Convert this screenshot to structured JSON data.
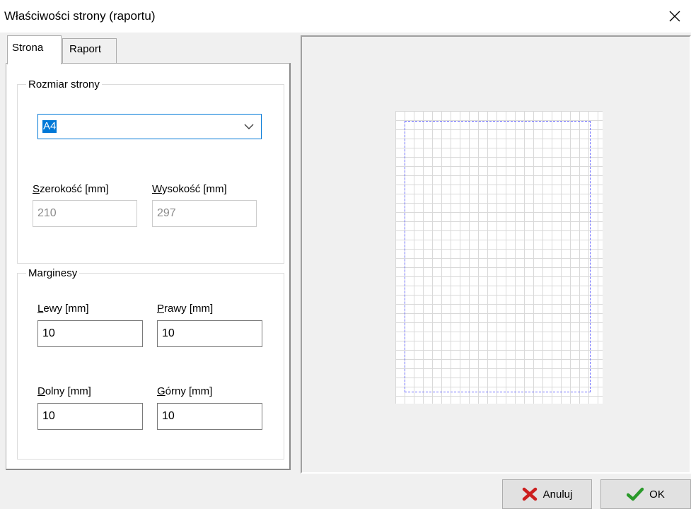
{
  "window": {
    "title": "Właściwości strony (raportu)",
    "close_icon": "close-icon"
  },
  "tabs": [
    {
      "label": "Strona",
      "active": true
    },
    {
      "label": "Raport",
      "active": false
    }
  ],
  "page_size_group": {
    "label": "Rozmiar strony",
    "selected": "A4",
    "width_label_accel": "S",
    "width_label_rest": "zerokość [mm]",
    "width_value": "210",
    "height_label_accel": "W",
    "height_label_rest": "ysokość [mm]",
    "height_value": "297"
  },
  "margins_group": {
    "label": "Marginesy",
    "left_label_accel": "L",
    "left_label_rest": "ewy [mm]",
    "left_value": "10",
    "right_label_accel": "P",
    "right_label_rest": "rawy [mm]",
    "right_value": "10",
    "bottom_label_accel": "D",
    "bottom_label_rest": "olny [mm]",
    "bottom_value": "10",
    "top_label_accel": "G",
    "top_label_rest": "órny [mm]",
    "top_value": "10"
  },
  "buttons": {
    "cancel_label": "Anuluj",
    "cancel_icon": "x-icon",
    "ok_label": "OK",
    "ok_icon": "checkmark-icon"
  },
  "colors": {
    "accent": "#0078d7",
    "margin_line": "#6b6bff",
    "cancel_icon": "#cc1f1f",
    "ok_icon": "#2a9a2a"
  }
}
